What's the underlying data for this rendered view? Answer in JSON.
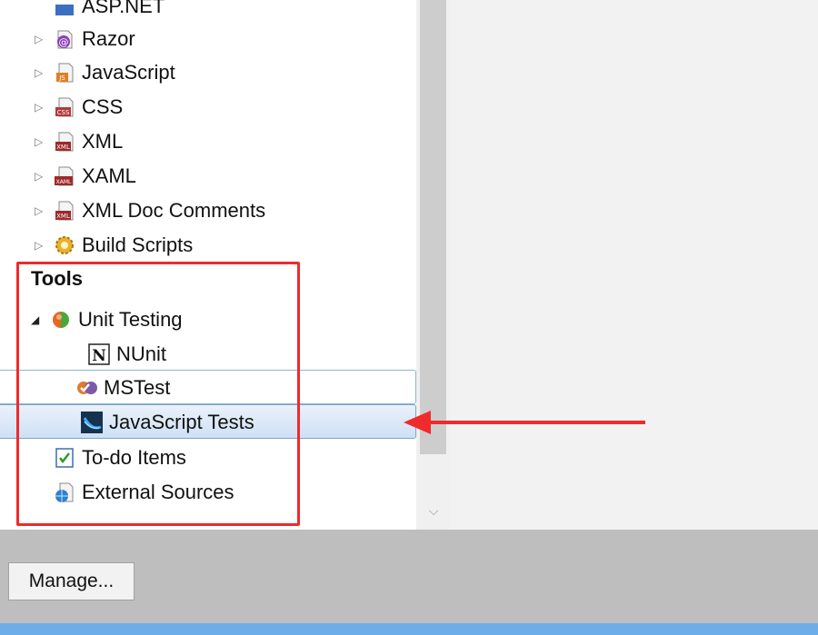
{
  "tree": {
    "items_above": [
      {
        "label": "ASP.NET",
        "icon": "aspnet-icon"
      },
      {
        "label": "Razor",
        "icon": "razor-icon"
      },
      {
        "label": "JavaScript",
        "icon": "javascript-file-icon"
      },
      {
        "label": "CSS",
        "icon": "css-file-icon"
      },
      {
        "label": "XML",
        "icon": "xml-file-icon"
      },
      {
        "label": "XAML",
        "icon": "xaml-file-icon"
      },
      {
        "label": "XML Doc Comments",
        "icon": "xml-doc-icon"
      },
      {
        "label": "Build Scripts",
        "icon": "gear-icon"
      }
    ],
    "tools": {
      "header": "Tools",
      "unit_testing": {
        "label": "Unit Testing",
        "children": [
          {
            "label": "NUnit",
            "icon": "nunit-icon"
          },
          {
            "label": "MSTest",
            "icon": "mstest-icon"
          },
          {
            "label": "JavaScript Tests",
            "icon": "javascript-tests-icon"
          }
        ]
      },
      "todo": {
        "label": "To-do Items"
      },
      "external": {
        "label": "External Sources"
      }
    }
  },
  "footer": {
    "manage_label": "Manage..."
  },
  "colors": {
    "highlight_frame": "#ef2b2b",
    "arrow": "#ef2b2b",
    "selection": "#cfe0f5"
  }
}
